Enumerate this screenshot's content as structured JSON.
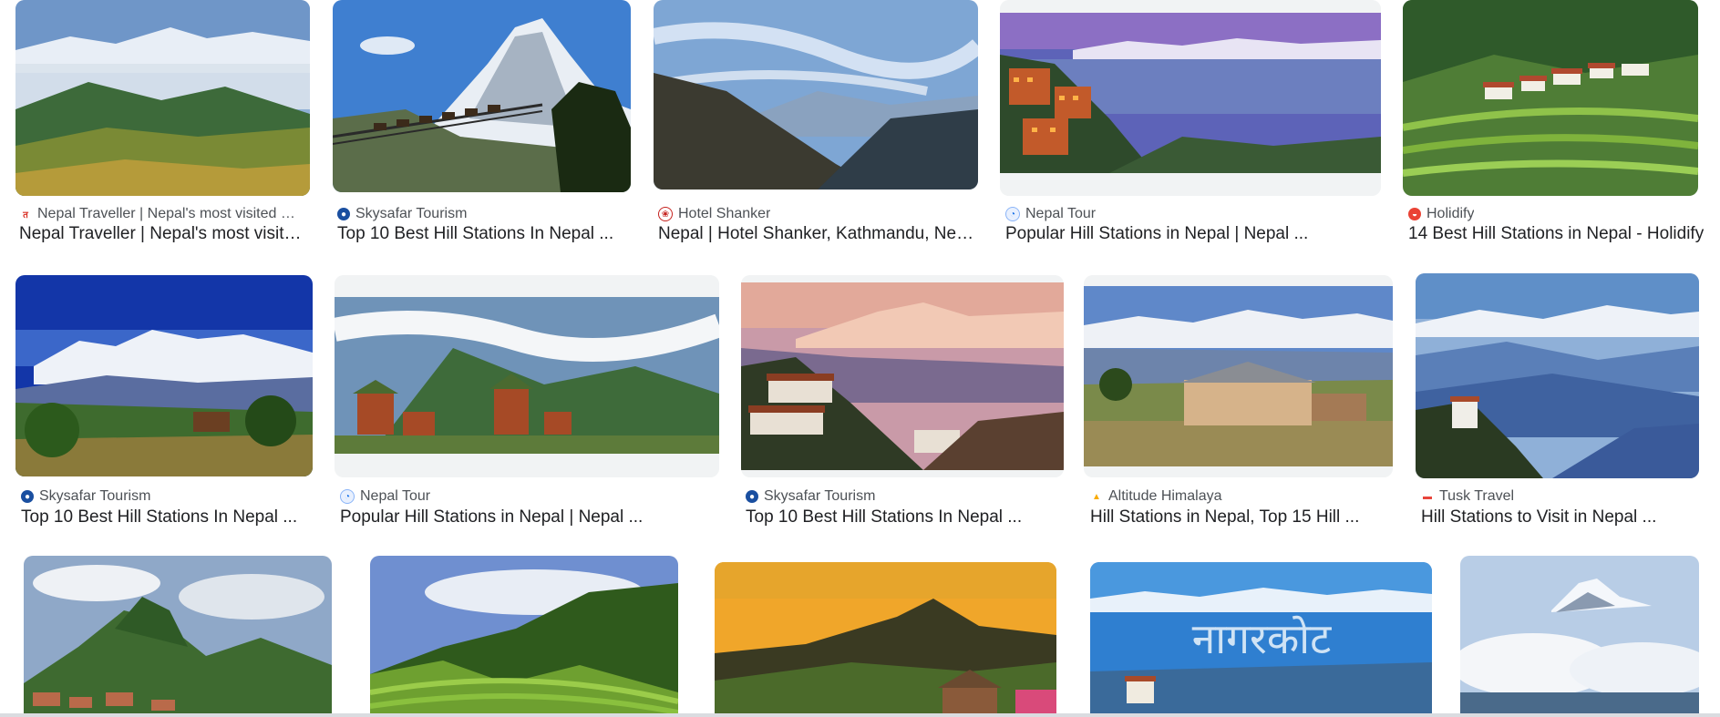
{
  "results": [
    {
      "source": "Nepal Traveller | Nepal's most visited w...",
      "title": "Nepal Traveller | Nepal's most visite...",
      "favicon": "nepal-traveller-icon",
      "favicon_color": "#d93025",
      "image": "mountains-valley-clouds"
    },
    {
      "source": "Skysafar Tourism",
      "title": "Top 10 Best Hill Stations In Nepal ...",
      "favicon": "globe-icon",
      "favicon_color": "#1a4fa0",
      "image": "snow-peak-suspension-bridge"
    },
    {
      "source": "Hotel Shanker",
      "title": "Nepal | Hotel Shanker, Kathmandu, Nepal",
      "favicon": "hotel-shanker-icon",
      "favicon_color": "#c5221f",
      "image": "hills-sky-clouds"
    },
    {
      "source": "Nepal Tour",
      "title": "Popular Hill Stations in Nepal | Nepal ...",
      "favicon": "nepal-tour-icon",
      "favicon_color": "#8ab4f8",
      "image": "hill-town-sunset-himalaya"
    },
    {
      "source": "Holidify",
      "title": "14 Best Hill Stations in Nepal - Holidify",
      "favicon": "holidify-icon",
      "favicon_color": "#ea4335",
      "image": "green-terraced-village"
    },
    {
      "source": "Skysafar Tourism",
      "title": "Top 10 Best Hill Stations In Nepal ...",
      "favicon": "globe-icon",
      "favicon_color": "#1a4fa0",
      "image": "blue-sky-snow-range-village"
    },
    {
      "source": "Nepal Tour",
      "title": "Popular Hill Stations in Nepal | Nepal ...",
      "favicon": "nepal-tour-icon",
      "favicon_color": "#8ab4f8",
      "image": "pagoda-village-clouds"
    },
    {
      "source": "Skysafar Tourism",
      "title": "Top 10 Best Hill Stations In Nepal ...",
      "favicon": "globe-icon",
      "favicon_color": "#1a4fa0",
      "image": "pink-peak-stone-village"
    },
    {
      "source": "Altitude Himalaya",
      "title": "Hill Stations in Nepal, Top 15 Hill ...",
      "favicon": "altitude-himalaya-icon",
      "favicon_color": "#f9ab00",
      "image": "farmhouse-snow-range"
    },
    {
      "source": "Tusk Travel",
      "title": "Hill Stations to Visit in Nepal ...",
      "favicon": "tusk-travel-icon",
      "favicon_color": "#e8453c",
      "image": "blue-misty-valleys"
    },
    {
      "source": "",
      "title": "",
      "favicon": "",
      "favicon_color": "#cccccc",
      "image": "green-hill-town-cloudy"
    },
    {
      "source": "",
      "title": "",
      "favicon": "",
      "favicon_color": "#cccccc",
      "image": "terraced-green-hills"
    },
    {
      "source": "",
      "title": "",
      "favicon": "",
      "favicon_color": "#cccccc",
      "image": "golden-sunset-hills"
    },
    {
      "source": "",
      "title": "",
      "favicon": "",
      "favicon_color": "#cccccc",
      "image": "nagarkot-text-mountains"
    },
    {
      "source": "",
      "title": "",
      "favicon": "",
      "favicon_color": "#cccccc",
      "image": "peak-above-clouds"
    }
  ],
  "overlay_text": {
    "nagarkot": "नागरकोट"
  }
}
